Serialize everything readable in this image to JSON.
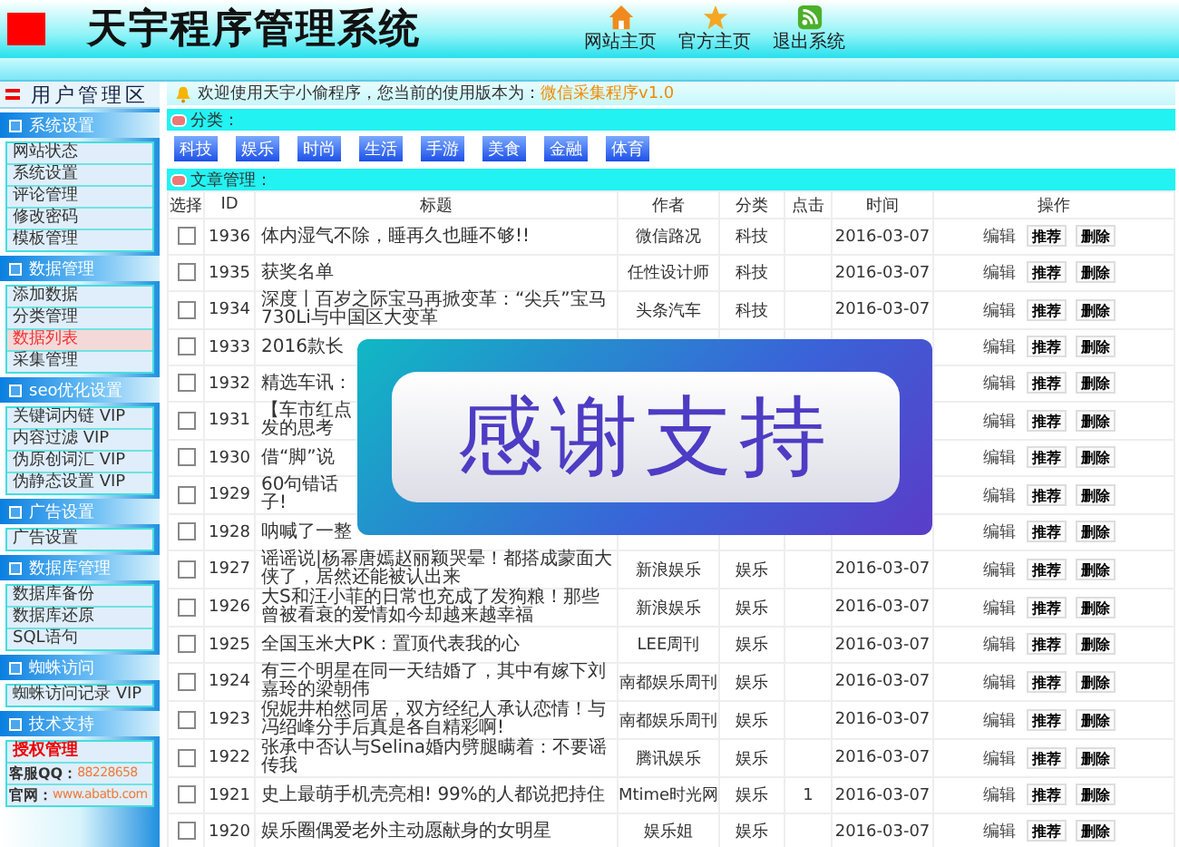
{
  "header": {
    "title": "天宇程序管理系统",
    "nav": [
      {
        "kind": "home",
        "label": "网站主页"
      },
      {
        "kind": "star",
        "label": "官方主页"
      },
      {
        "kind": "exit",
        "label": "退出系统"
      }
    ]
  },
  "sidebar": {
    "title": "用户管理区",
    "groups": [
      {
        "title": "系统设置",
        "items": [
          {
            "kind": "link",
            "label": "网站状态",
            "selected": false
          },
          {
            "kind": "link",
            "label": "系统设置",
            "selected": false
          },
          {
            "kind": "link",
            "label": "评论管理",
            "selected": false
          },
          {
            "kind": "link",
            "label": "修改密码",
            "selected": false
          },
          {
            "kind": "link",
            "label": "模板管理",
            "selected": false
          }
        ]
      },
      {
        "title": "数据管理",
        "items": [
          {
            "kind": "link",
            "label": "添加数据",
            "selected": false
          },
          {
            "kind": "link",
            "label": "分类管理",
            "selected": false
          },
          {
            "kind": "link",
            "label": "数据列表",
            "selected": true
          },
          {
            "kind": "link",
            "label": "采集管理",
            "selected": false
          }
        ]
      },
      {
        "title": "seo优化设置",
        "items": [
          {
            "kind": "link",
            "label": "关键词内链 VIP",
            "selected": false
          },
          {
            "kind": "link",
            "label": "内容过滤 VIP",
            "selected": false
          },
          {
            "kind": "link",
            "label": "伪原创词汇 VIP",
            "selected": false
          },
          {
            "kind": "link",
            "label": "伪静态设置 VIP",
            "selected": false
          }
        ]
      },
      {
        "title": "广告设置",
        "items": [
          {
            "kind": "link",
            "label": "广告设置",
            "selected": false
          }
        ]
      },
      {
        "title": "数据库管理",
        "items": [
          {
            "kind": "link",
            "label": "数据库备份",
            "selected": false
          },
          {
            "kind": "link",
            "label": "数据库还原",
            "selected": false
          },
          {
            "kind": "link",
            "label": "SQL语句",
            "selected": false
          }
        ]
      },
      {
        "title": "蜘蛛访问",
        "items": [
          {
            "kind": "link",
            "label": "蜘蛛访问记录 VIP",
            "selected": false
          }
        ]
      },
      {
        "title": "技术支持",
        "items": [
          {
            "kind": "alert",
            "label": "授权管理"
          },
          {
            "kind": "contact",
            "label": "客服QQ：",
            "value": "88228658"
          },
          {
            "kind": "contact",
            "label": "官网：",
            "value": "www.abatb.com"
          }
        ]
      }
    ]
  },
  "welcome": {
    "text": "欢迎使用天宇小偷程序，您当前的使用版本为：",
    "version": "微信采集程序v1.0"
  },
  "categories": {
    "title": "分类：",
    "items": [
      "科技",
      "娱乐",
      "时尚",
      "生活",
      "手游",
      "美食",
      "金融",
      "体育"
    ]
  },
  "articles": {
    "title": "文章管理：",
    "columns": [
      "选择",
      "ID",
      "标题",
      "作者",
      "分类",
      "点击",
      "时间",
      "操作"
    ],
    "rows": [
      {
        "checked": false,
        "id": "1936",
        "title": "体内湿气不除，睡再久也睡不够!!",
        "author": "微信路况",
        "category": "科技",
        "time": "2016-03-07",
        "actions": [
          "编辑",
          "推荐",
          "删除"
        ]
      },
      {
        "checked": false,
        "id": "1935",
        "title": "获奖名单",
        "author": "任性设计师",
        "category": "科技",
        "time": "2016-03-07",
        "actions": [
          "编辑",
          "推荐",
          "删除"
        ]
      },
      {
        "checked": false,
        "id": "1934",
        "title": "深度丨百岁之际宝马再掀变革：“尖兵”宝马730Li与中国区大变革",
        "author": "头条汽车",
        "category": "科技",
        "time": "2016-03-07",
        "actions": [
          "编辑",
          "推荐",
          "删除"
        ]
      },
      {
        "checked": false,
        "id": "1933",
        "title": "2016款长",
        "actions": [
          "编辑",
          "推荐",
          "删除"
        ]
      },
      {
        "checked": false,
        "id": "1932",
        "title": "精选车讯：",
        "actions": [
          "编辑",
          "推荐",
          "删除"
        ]
      },
      {
        "checked": false,
        "id": "1931",
        "title": "【车市红点发的思考",
        "actions": [
          "编辑",
          "推荐",
          "删除"
        ]
      },
      {
        "checked": false,
        "id": "1930",
        "title": "借“脚”说",
        "actions": [
          "编辑",
          "推荐",
          "删除"
        ]
      },
      {
        "checked": false,
        "id": "1929",
        "title": "60句错话子!",
        "actions": [
          "编辑",
          "推荐",
          "删除"
        ]
      },
      {
        "checked": false,
        "id": "1928",
        "title": "呐喊了一整",
        "actions": [
          "编辑",
          "推荐",
          "删除"
        ]
      },
      {
        "checked": false,
        "id": "1927",
        "title": "谣谣说|杨幂唐嫣赵丽颖哭晕！都搭成蒙面大侠了，居然还能被认出来",
        "author": "新浪娱乐",
        "category": "娱乐",
        "time": "2016-03-07",
        "actions": [
          "编辑",
          "推荐",
          "删除"
        ]
      },
      {
        "checked": false,
        "id": "1926",
        "title": "大S和汪小菲的日常也充成了发狗粮！那些曾被看衰的爱情如今却越来越幸福",
        "author": "新浪娱乐",
        "category": "娱乐",
        "time": "2016-03-07",
        "actions": [
          "编辑",
          "推荐",
          "删除"
        ]
      },
      {
        "checked": false,
        "id": "1925",
        "title": "全国玉米大PK：置顶代表我的心",
        "author": "LEE周刊",
        "category": "娱乐",
        "time": "2016-03-07",
        "actions": [
          "编辑",
          "推荐",
          "删除"
        ]
      },
      {
        "checked": false,
        "id": "1924",
        "title": "有三个明星在同一天结婚了，其中有嫁下刘嘉玲的梁朝伟",
        "author": "南都娱乐周刊",
        "category": "娱乐",
        "time": "2016-03-07",
        "actions": [
          "编辑",
          "推荐",
          "删除"
        ]
      },
      {
        "checked": false,
        "id": "1923",
        "title": "倪妮井柏然同居，双方经纪人承认恋情！与冯绍峰分手后真是各自精彩啊!",
        "author": "南都娱乐周刊",
        "category": "娱乐",
        "time": "2016-03-07",
        "actions": [
          "编辑",
          "推荐",
          "删除"
        ]
      },
      {
        "checked": false,
        "id": "1922",
        "title": "张承中否认与Selina婚内劈腿瞒着：不要谣传我",
        "author": "腾讯娱乐",
        "category": "娱乐",
        "time": "2016-03-07",
        "actions": [
          "编辑",
          "推荐",
          "删除"
        ]
      },
      {
        "checked": false,
        "id": "1921",
        "title": "史上最萌手机壳亮相! 99%的人都说把持住",
        "author": "Mtime时光网",
        "category": "娱乐",
        "clicks": "1",
        "time": "2016-03-07",
        "actions": [
          "编辑",
          "推荐",
          "删除"
        ]
      },
      {
        "checked": false,
        "id": "1920",
        "title": "娱乐圈偶爱老外主动愿献身的女明星",
        "author": "娱乐姐",
        "category": "娱乐",
        "time": "2016-03-07",
        "actions": [
          "编辑",
          "推荐",
          "删除"
        ]
      }
    ]
  },
  "overlay": {
    "text": "感谢支持"
  }
}
